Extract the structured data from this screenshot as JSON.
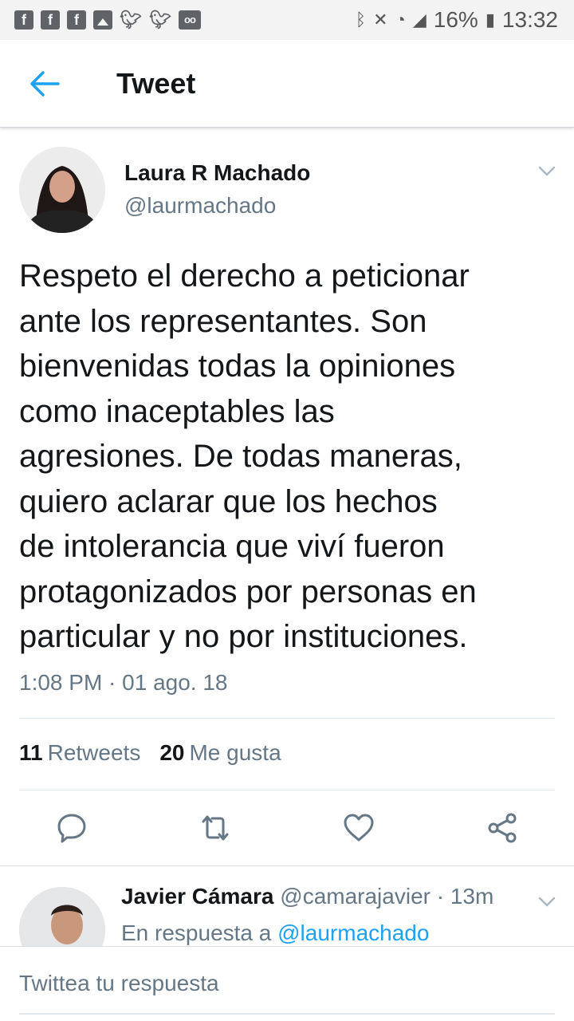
{
  "status_bar": {
    "battery": "16%",
    "time": "13:32"
  },
  "header": {
    "title": "Tweet"
  },
  "tweet": {
    "author_name": "Laura R Machado",
    "author_handle": "@laurmachado",
    "text": "Respeto el derecho a peticionar\nante los representantes. Son\nbienvenidas todas la opiniones\ncomo inaceptables las\nagresiones. De todas maneras,\nquiero aclarar que los hechos\nde intolerancia que viví fueron\nprotagonizados por personas en\nparticular y no por instituciones.",
    "timestamp": "1:08 PM · 01 ago. 18",
    "retweets_count": "11",
    "retweets_label": "Retweets",
    "likes_count": "20",
    "likes_label": "Me gusta"
  },
  "reply": {
    "author_name": "Javier Cámara",
    "author_handle": "@camarajavier",
    "age": "· 13m",
    "in_reply_to_label": "En respuesta a",
    "in_reply_to_handle": "@laurmachado"
  },
  "compose": {
    "placeholder": "Twittea tu respuesta"
  },
  "colors": {
    "accent": "#1da1f2",
    "text": "#14171a",
    "secondary_text": "#657786"
  }
}
